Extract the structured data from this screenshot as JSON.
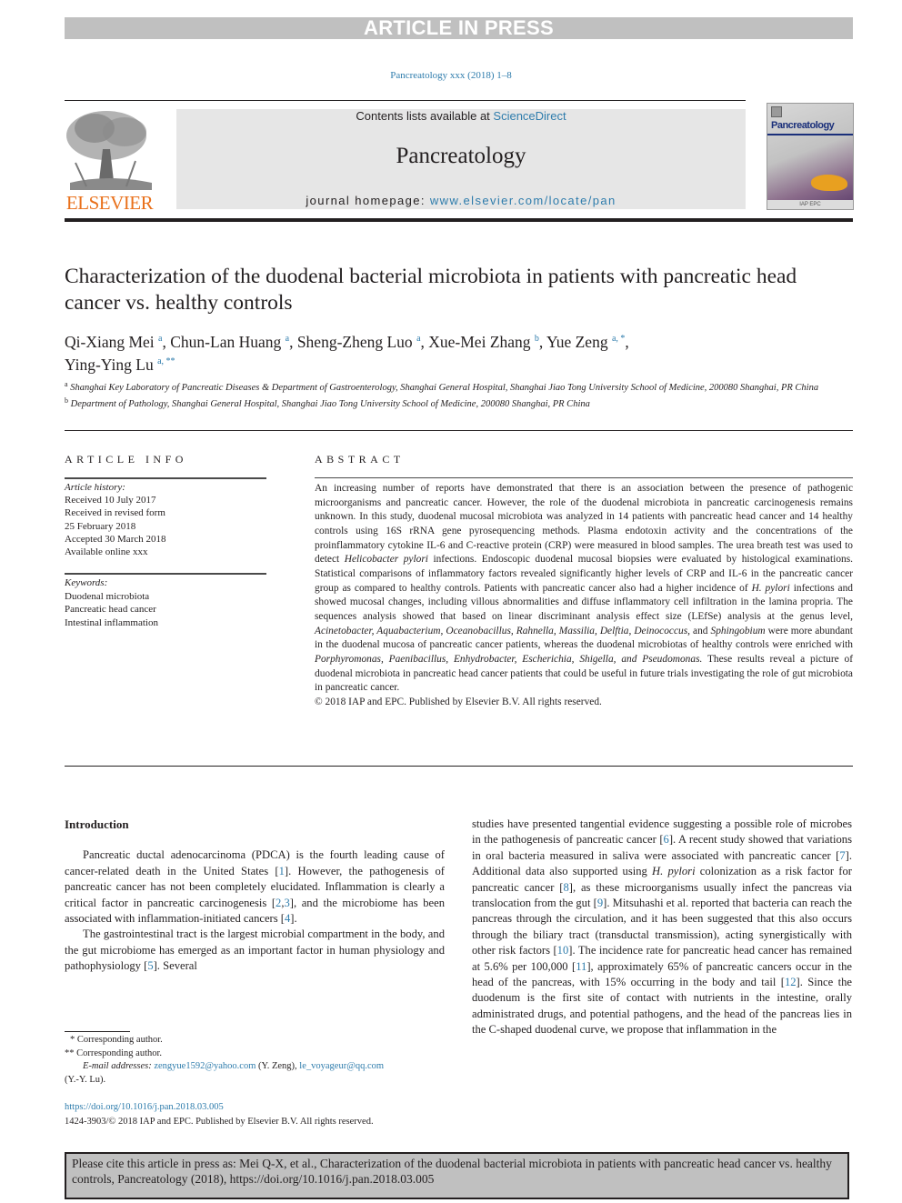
{
  "banner": {
    "text": "ARTICLE IN PRESS"
  },
  "journal_ref": "Pancreatology xxx (2018) 1–8",
  "publisher_logo": {
    "text": "ELSEVIER"
  },
  "masthead": {
    "contents_prefix": "Contents lists available at ",
    "contents_link": "ScienceDirect",
    "journal_name": "Pancreatology",
    "homepage_prefix": "journal homepage: ",
    "homepage_link": "www.elsevier.com/locate/pan"
  },
  "cover": {
    "title": "Pancreatology",
    "footer": "IAP EPC"
  },
  "article": {
    "title": "Characterization of the duodenal bacterial microbiota in patients with pancreatic head cancer vs. healthy controls",
    "authors": [
      {
        "name": "Qi-Xiang Mei",
        "sup": "a",
        "sep": ", "
      },
      {
        "name": "Chun-Lan Huang",
        "sup": "a",
        "sep": ", "
      },
      {
        "name": "Sheng-Zheng Luo",
        "sup": "a",
        "sep": ", "
      },
      {
        "name": "Xue-Mei Zhang",
        "sup": "b",
        "sep": ", "
      },
      {
        "name": "Yue Zeng",
        "sup": "a, *",
        "sep": ","
      },
      {
        "name": "Ying-Ying Lu",
        "sup": "a, **",
        "sep": ""
      }
    ],
    "affiliations": [
      {
        "mark": "a",
        "text": "Shanghai Key Laboratory of Pancreatic Diseases & Department of Gastroenterology, Shanghai General Hospital, Shanghai Jiao Tong University School of Medicine, 200080 Shanghai, PR China"
      },
      {
        "mark": "b",
        "text": "Department of Pathology, Shanghai General Hospital, Shanghai Jiao Tong University School of Medicine, 200080 Shanghai, PR China"
      }
    ]
  },
  "article_info": {
    "heading": "ARTICLE INFO",
    "history_label": "Article history:",
    "history": [
      "Received 10 July 2017",
      "Received in revised form",
      "25 February 2018",
      "Accepted 30 March 2018",
      "Available online xxx"
    ],
    "keywords_label": "Keywords:",
    "keywords": [
      "Duodenal microbiota",
      "Pancreatic head cancer",
      "Intestinal inflammation"
    ]
  },
  "abstract": {
    "heading": "ABSTRACT",
    "segments": [
      {
        "t": "An increasing number of reports have demonstrated that there is an association between the presence of pathogenic microorganisms and pancreatic cancer. However, the role of the duodenal microbiota in pancreatic carcinogenesis remains unknown. In this study, duodenal mucosal microbiota was analyzed in 14 patients with pancreatic head cancer and 14 healthy controls using 16S rRNA gene pyrosequencing methods. Plasma endotoxin activity and the concentrations of the proinflammatory cytokine IL-6 and C-reactive protein (CRP) were measured in blood samples. The urea breath test was used to detect ",
        "i": false
      },
      {
        "t": "Helicobacter pylori",
        "i": true
      },
      {
        "t": " infections. Endoscopic duodenal mucosal biopsies were evaluated by histological examinations. Statistical comparisons of inflammatory factors revealed significantly higher levels of CRP and IL-6 in the pancreatic cancer group as compared to healthy controls. Patients with pancreatic cancer also had a higher incidence of ",
        "i": false
      },
      {
        "t": "H. pylori",
        "i": true
      },
      {
        "t": " infections and showed mucosal changes, including villous abnormalities and diffuse inflammatory cell infiltration in the lamina propria. The sequences analysis showed that based on linear discriminant analysis effect size (LEfSe) analysis at the genus level, ",
        "i": false
      },
      {
        "t": "Acinetobacter, Aquabacterium, Oceanobacillus, Rahnella, Massilia, Delftia, Deinococcus,",
        "i": true
      },
      {
        "t": " and ",
        "i": false
      },
      {
        "t": "Sphingobium",
        "i": true
      },
      {
        "t": " were more abundant in the duodenal mucosa of pancreatic cancer patients, whereas the duodenal microbiotas of healthy controls were enriched with ",
        "i": false
      },
      {
        "t": "Porphyromonas, Paenibacillus, Enhydrobacter, Escherichia, Shigella, and Pseudomonas.",
        "i": true
      },
      {
        "t": " These results reveal a picture of duodenal microbiota in pancreatic head cancer patients that could be useful in future trials investigating the role of gut microbiota in pancreatic cancer.",
        "i": false
      }
    ],
    "copyright": "© 2018 IAP and EPC. Published by Elsevier B.V. All rights reserved."
  },
  "body": {
    "intro_heading": "Introduction",
    "left_paragraphs": [
      [
        {
          "t": "Pancreatic ductal adenocarcinoma (PDCA) is the fourth leading cause of cancer-related death in the United States ["
        },
        {
          "t": "1",
          "r": true
        },
        {
          "t": "]. However, the pathogenesis of pancreatic cancer has not been completely elucidated. Inflammation is clearly a critical factor in pancreatic carcinogenesis ["
        },
        {
          "t": "2",
          "r": true
        },
        {
          "t": ","
        },
        {
          "t": "3",
          "r": true
        },
        {
          "t": "], and the microbiome has been associated with inflammation-initiated cancers ["
        },
        {
          "t": "4",
          "r": true
        },
        {
          "t": "]."
        }
      ],
      [
        {
          "t": "The gastrointestinal tract is the largest microbial compartment in the body, and the gut microbiome has emerged as an important factor in human physiology and pathophysiology ["
        },
        {
          "t": "5",
          "r": true
        },
        {
          "t": "]. Several"
        }
      ]
    ],
    "right_paragraph": [
      {
        "t": "studies have presented tangential evidence suggesting a possible role of microbes in the pathogenesis of pancreatic cancer ["
      },
      {
        "t": "6",
        "r": true
      },
      {
        "t": "]. A recent study showed that variations in oral bacteria measured in saliva were associated with pancreatic cancer ["
      },
      {
        "t": "7",
        "r": true
      },
      {
        "t": "]. Additional data also supported using "
      },
      {
        "t": "H. pylori",
        "i": true
      },
      {
        "t": " colonization as a risk factor for pancreatic cancer ["
      },
      {
        "t": "8",
        "r": true
      },
      {
        "t": "], as these microorganisms usually infect the pancreas via translocation from the gut ["
      },
      {
        "t": "9",
        "r": true
      },
      {
        "t": "]. Mitsuhashi et al. reported that bacteria can reach the pancreas through the circulation, and it has been suggested that this also occurs through the biliary tract (transductal transmission), acting synergistically with other risk factors ["
      },
      {
        "t": "10",
        "r": true
      },
      {
        "t": "]. The incidence rate for pancreatic head cancer has remained at 5.6% per 100,000 ["
      },
      {
        "t": "11",
        "r": true
      },
      {
        "t": "], approximately 65% of pancreatic cancers occur in the head of the pancreas, with 15% occurring in the body and tail ["
      },
      {
        "t": "12",
        "r": true
      },
      {
        "t": "]. Since the duodenum is the first site of contact with nutrients in the intestine, orally administrated drugs, and potential pathogens, and the head of the pancreas lies in the C-shaped duodenal curve, we propose that inflammation in the"
      }
    ]
  },
  "footnotes": {
    "star1": "*  Corresponding author.",
    "star2": "**  Corresponding author.",
    "email_label": "E-mail addresses: ",
    "email1": "zengyue1592@yahoo.com",
    "email1_owner": " (Y. Zeng), ",
    "email2": "le_voyageur@qq.com",
    "email2_owner": "(Y.-Y. Lu).",
    "doi": "https://doi.org/10.1016/j.pan.2018.03.005",
    "issn_copyright": "1424-3903/© 2018 IAP and EPC. Published by Elsevier B.V. All rights reserved."
  },
  "cite_box": {
    "text": "Please cite this article in press as: Mei Q-X, et al., Characterization of the duodenal bacterial microbiota in patients with pancreatic head cancer vs. healthy controls, Pancreatology (2018), https://doi.org/10.1016/j.pan.2018.03.005"
  },
  "colors": {
    "link": "#2e7cac",
    "banner": "#c0c0c0",
    "elsevier_orange": "#e9711c",
    "masthead_bg": "#e6e6e6"
  }
}
